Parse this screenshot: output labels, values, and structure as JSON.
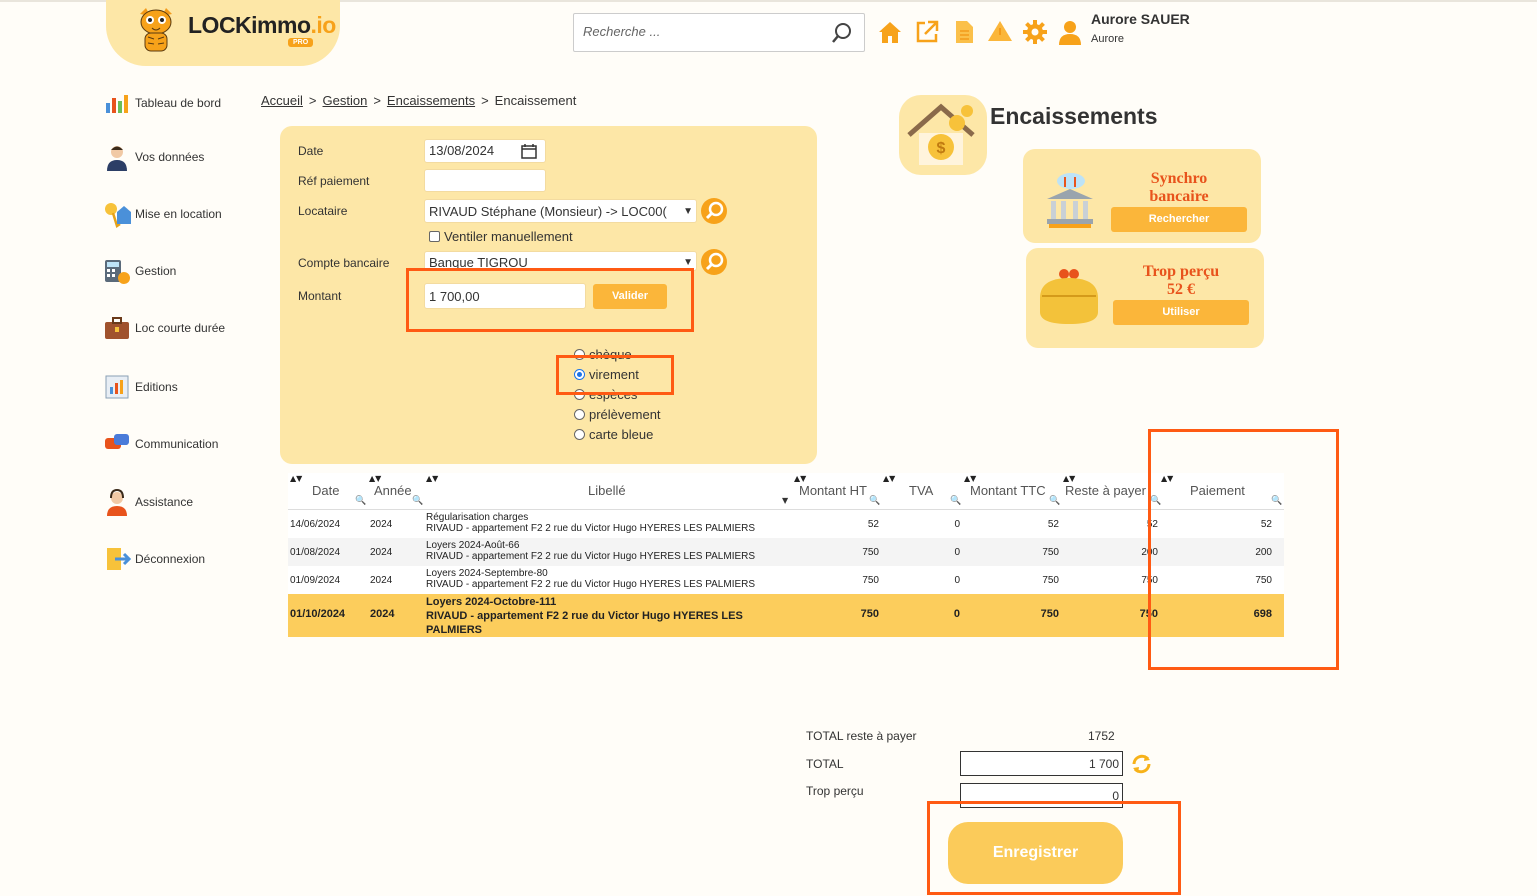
{
  "app": {
    "brand": "LOCKimmo",
    "brand_suffix": ".io",
    "badge": "PRO"
  },
  "header": {
    "search_placeholder": "Recherche ...",
    "user_name": "Aurore SAUER",
    "user_sub": "Aurore",
    "icons": [
      "home-icon",
      "external-link-icon",
      "document-icon",
      "alert-icon",
      "gear-icon",
      "user-icon"
    ]
  },
  "sidebar": {
    "items": [
      {
        "label": "Tableau de bord",
        "icon": "dashboard-chart-icon"
      },
      {
        "label": "Vos données",
        "icon": "person-icon"
      },
      {
        "label": "Mise en location",
        "icon": "keys-house-icon"
      },
      {
        "label": "Gestion",
        "icon": "calculator-icon"
      },
      {
        "label": "Loc courte durée",
        "icon": "suitcase-icon"
      },
      {
        "label": "Editions",
        "icon": "report-icon"
      },
      {
        "label": "Communication",
        "icon": "chat-icon"
      },
      {
        "label": "Assistance",
        "icon": "headset-icon"
      },
      {
        "label": "Déconnexion",
        "icon": "logout-door-icon"
      }
    ]
  },
  "breadcrumb": {
    "items": [
      "Accueil",
      "Gestion",
      "Encaissements"
    ],
    "current": "Encaissement",
    "sep": ">"
  },
  "form": {
    "date_label": "Date",
    "date_value": "13/08/2024",
    "ref_label": "Réf paiement",
    "ref_value": "",
    "locataire_label": "Locataire",
    "locataire_value": "RIVAUD Stéphane (Monsieur) -> LOC00(",
    "ventiler_label": "Ventiler manuellement",
    "compte_label": "Compte bancaire",
    "compte_value": "Banque TIGROU",
    "montant_label": "Montant",
    "montant_value": "1 700,00",
    "valider_label": "Valider",
    "payment_methods": [
      {
        "label": "chèque",
        "selected": false
      },
      {
        "label": "virement",
        "selected": true
      },
      {
        "label": "espèces",
        "selected": false
      },
      {
        "label": "prélèvement",
        "selected": false
      },
      {
        "label": "carte bleue",
        "selected": false
      }
    ]
  },
  "encaissements": {
    "title": "Encaissements",
    "synchro": {
      "title_line1": "Synchro",
      "title_line2": "bancaire",
      "button": "Rechercher"
    },
    "trop_percu": {
      "title_line1": "Trop perçu",
      "title_line2": "52 €",
      "button": "Utiliser"
    }
  },
  "table": {
    "headers": [
      "Date",
      "Année",
      "Libellé",
      "Montant HT",
      "TVA",
      "Montant TTC",
      "Reste à payer",
      "Paiement"
    ],
    "rows": [
      {
        "date": "14/06/2024",
        "annee": "2024",
        "lib1": "Régularisation charges",
        "lib2": "RIVAUD - appartement F2 2 rue du Victor Hugo HYERES LES PALMIERS",
        "lib3": "",
        "ht": "52",
        "tva": "0",
        "ttc": "52",
        "reste": "52",
        "paiement": "52"
      },
      {
        "date": "01/08/2024",
        "annee": "2024",
        "lib1": "Loyers 2024-Août-66",
        "lib2": "RIVAUD - appartement F2 2 rue du Victor Hugo HYERES LES PALMIERS",
        "lib3": "",
        "ht": "750",
        "tva": "0",
        "ttc": "750",
        "reste": "200",
        "paiement": "200"
      },
      {
        "date": "01/09/2024",
        "annee": "2024",
        "lib1": "Loyers 2024-Septembre-80",
        "lib2": "RIVAUD - appartement F2 2 rue du Victor Hugo HYERES LES PALMIERS",
        "lib3": "",
        "ht": "750",
        "tva": "0",
        "ttc": "750",
        "reste": "750",
        "paiement": "750"
      },
      {
        "date": "01/10/2024",
        "annee": "2024",
        "lib1": "Loyers 2024-Octobre-111",
        "lib2": "RIVAUD - appartement F2 2 rue du Victor Hugo HYERES LES",
        "lib3": "PALMIERS",
        "ht": "750",
        "tva": "0",
        "ttc": "750",
        "reste": "750",
        "paiement": "698"
      }
    ]
  },
  "totals": {
    "reste_label": "TOTAL reste à payer",
    "reste_value": "1752",
    "total_label": "TOTAL",
    "total_value": "1 700",
    "trop_label": "Trop perçu",
    "trop_value": "0",
    "save_label": "Enregistrer"
  },
  "colors": {
    "accent": "#fbb63a",
    "panel": "#fde7a7",
    "highlight": "#ff5a13",
    "selected_row": "#fccd5c",
    "title_orange": "#e8531c"
  }
}
